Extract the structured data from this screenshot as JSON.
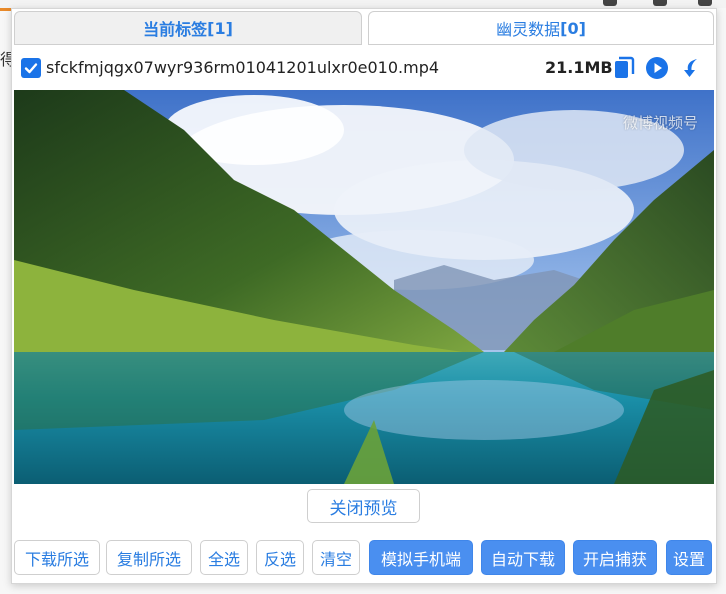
{
  "background": {
    "partial_char": "得"
  },
  "tabs": {
    "current": {
      "label": "当前标签",
      "count": "[1]"
    },
    "ghost": {
      "label": "幽灵数据",
      "count": "[0]"
    }
  },
  "file": {
    "checked": true,
    "name": "sfckfmjqgx07wyr936rm01041201ulxr0e010.mp4",
    "size": "21.1MB",
    "icons": [
      "copy-icon",
      "play-icon",
      "download-icon"
    ]
  },
  "preview": {
    "watermark": "微博视频号"
  },
  "close_preview_label": "关闭预览",
  "buttons": {
    "download_selected": "下载所选",
    "copy_selected": "复制所选",
    "select_all": "全选",
    "invert": "反选",
    "clear": "清空",
    "mobile": "模拟手机端",
    "auto_download": "自动下载",
    "capture": "开启捕获",
    "settings": "设置"
  },
  "colors": {
    "accent": "#2a7de1",
    "checkbox": "#1a73e8",
    "solid_button": "#4a8ff0"
  }
}
